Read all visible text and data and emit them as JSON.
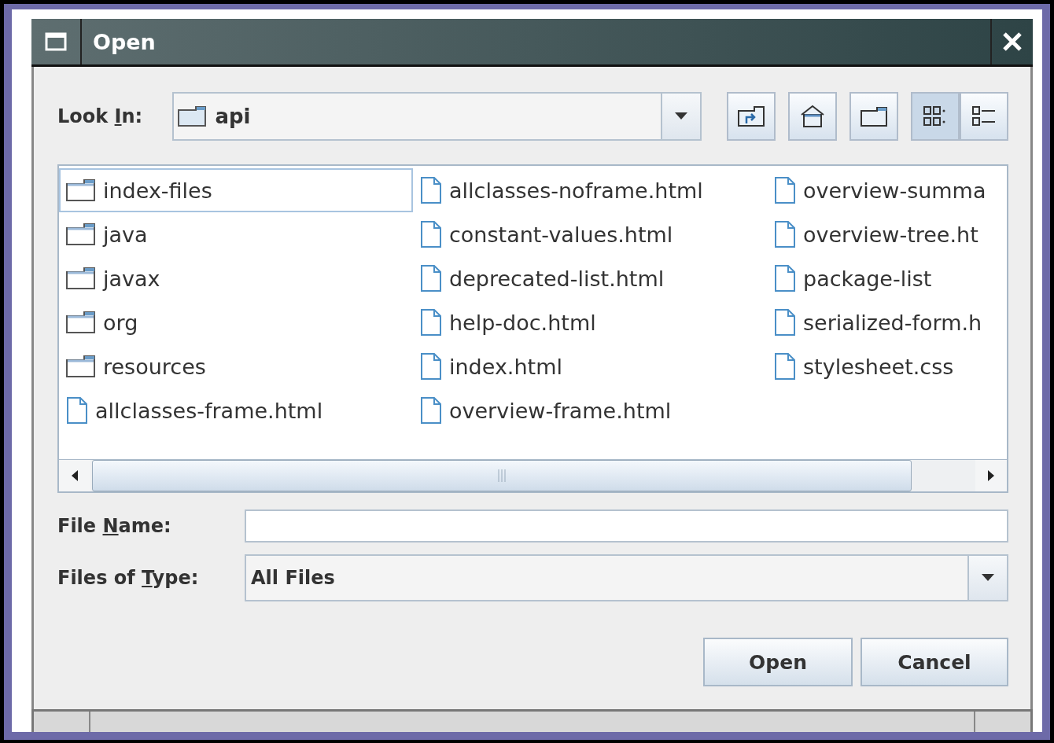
{
  "window": {
    "title": "Open"
  },
  "look_in": {
    "label_pre": "Look ",
    "mnemonic": "I",
    "label_post": "n:",
    "value": "api"
  },
  "toolbar": [
    {
      "kind": "up"
    },
    {
      "kind": "home"
    },
    {
      "kind": "new-folder"
    },
    {
      "kind": "list-view",
      "selected": true
    },
    {
      "kind": "details-view",
      "selected": false
    }
  ],
  "files": [
    {
      "name": "index-files",
      "kind": "folder",
      "selected": true
    },
    {
      "name": "java",
      "kind": "folder",
      "selected": false
    },
    {
      "name": "javax",
      "kind": "folder",
      "selected": false
    },
    {
      "name": "org",
      "kind": "folder",
      "selected": false
    },
    {
      "name": "resources",
      "kind": "folder",
      "selected": false
    },
    {
      "name": "allclasses-frame.html",
      "kind": "file",
      "selected": false
    },
    {
      "name": "allclasses-noframe.html",
      "kind": "file",
      "selected": false
    },
    {
      "name": "constant-values.html",
      "kind": "file",
      "selected": false
    },
    {
      "name": "deprecated-list.html",
      "kind": "file",
      "selected": false
    },
    {
      "name": "help-doc.html",
      "kind": "file",
      "selected": false
    },
    {
      "name": "index.html",
      "kind": "file",
      "selected": false
    },
    {
      "name": "overview-frame.html",
      "kind": "file",
      "selected": false
    },
    {
      "name": "overview-summa",
      "kind": "file",
      "selected": false
    },
    {
      "name": "overview-tree.ht",
      "kind": "file",
      "selected": false
    },
    {
      "name": "package-list",
      "kind": "file",
      "selected": false
    },
    {
      "name": "serialized-form.h",
      "kind": "file",
      "selected": false
    },
    {
      "name": "stylesheet.css",
      "kind": "file",
      "selected": false
    }
  ],
  "file_name": {
    "label_pre": "File ",
    "mnemonic": "N",
    "label_post": "ame:"
  },
  "files_of_type": {
    "label_pre": "Files of ",
    "mnemonic": "T",
    "label_post": "ype:",
    "value": "All Files"
  },
  "buttons": [
    "Open",
    "Cancel"
  ]
}
